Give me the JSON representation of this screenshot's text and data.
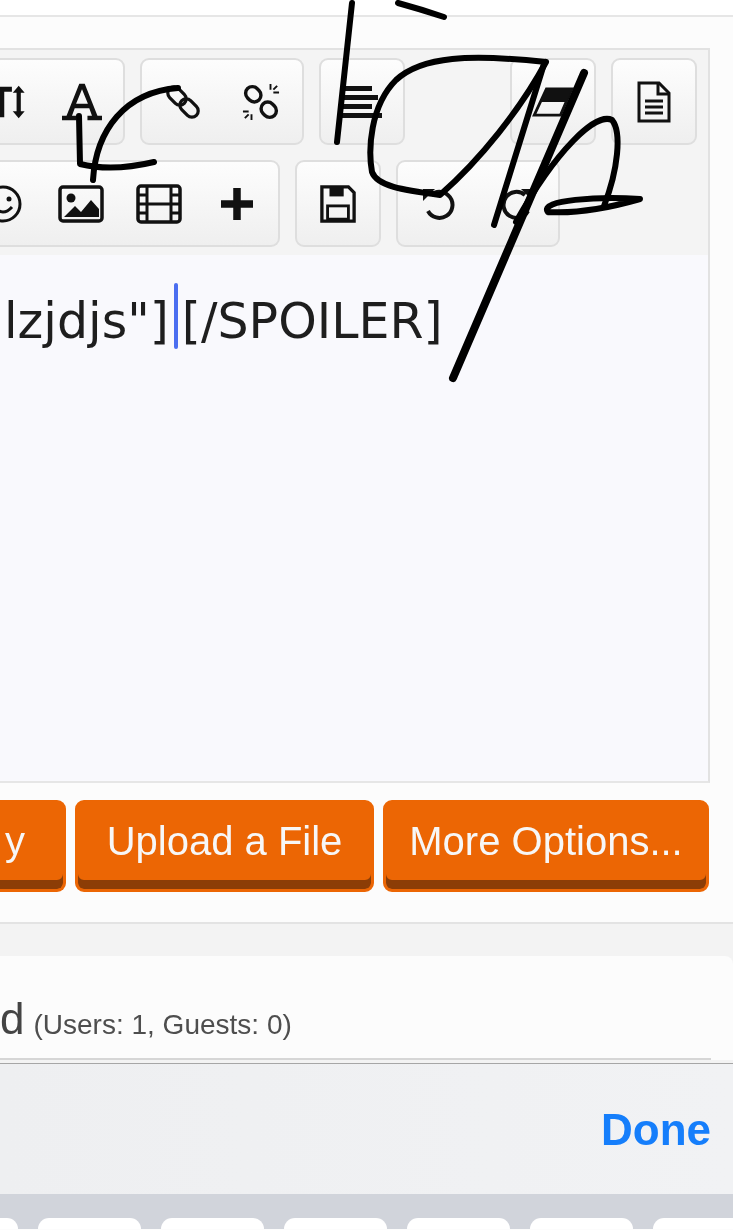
{
  "toolbar": {
    "rows": [
      {
        "groups": [
          {
            "buttons": [
              {
                "kind": "textsize"
              },
              {
                "kind": "font"
              }
            ]
          },
          {
            "buttons": [
              {
                "kind": "link"
              },
              {
                "kind": "unlink"
              }
            ]
          },
          {
            "buttons": [
              {
                "kind": "align"
              }
            ]
          },
          {
            "buttons": [
              {
                "kind": "eraser"
              }
            ]
          },
          {
            "buttons": [
              {
                "kind": "document"
              }
            ]
          }
        ]
      },
      {
        "groups": [
          {
            "buttons": [
              {
                "kind": "smiley"
              },
              {
                "kind": "image"
              },
              {
                "kind": "film"
              },
              {
                "kind": "plus"
              }
            ]
          },
          {
            "buttons": [
              {
                "kind": "save"
              }
            ]
          },
          {
            "buttons": [
              {
                "kind": "undo"
              },
              {
                "kind": "redo"
              }
            ]
          }
        ]
      }
    ]
  },
  "editor": {
    "value_before_caret": "lzjdjs\"]",
    "value_after_caret": "[/SPOILER]"
  },
  "buttons": [
    {
      "label": "y"
    },
    {
      "label": "Upload a File"
    },
    {
      "label": "More Options..."
    }
  ],
  "online_panel": {
    "title": "d",
    "counts": "(Users: 1, Guests: 0)"
  },
  "keyboard_accessory": {
    "done": "Done"
  },
  "freehand_marks": true
}
